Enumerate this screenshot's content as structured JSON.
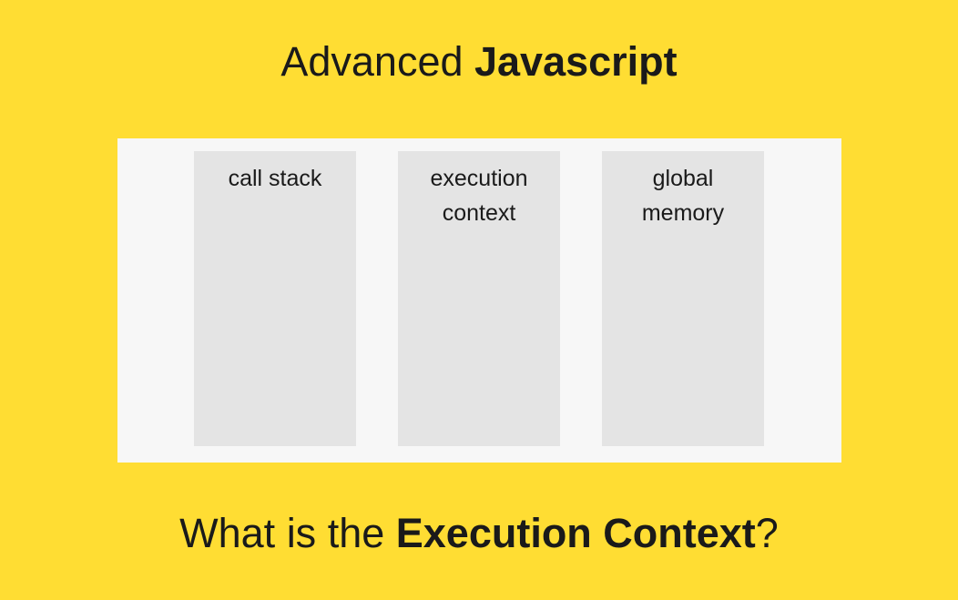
{
  "title": {
    "prefix": "Advanced ",
    "bold": "Javascript"
  },
  "columns": [
    {
      "line1": "call stack",
      "line2": ""
    },
    {
      "line1": "execution",
      "line2": "context"
    },
    {
      "line1": "global",
      "line2": "memory"
    }
  ],
  "subtitle": {
    "prefix": "What is the ",
    "bold": "Execution Context",
    "suffix": "?"
  }
}
